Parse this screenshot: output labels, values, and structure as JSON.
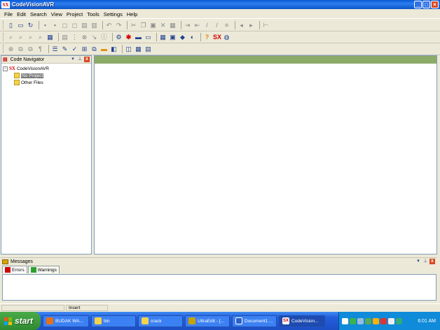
{
  "window": {
    "title": "CodeVisionAVR",
    "logo_text": "SX",
    "controls": [
      "_",
      "□",
      "×"
    ]
  },
  "menu": [
    "File",
    "Edit",
    "Search",
    "View",
    "Project",
    "Tools",
    "Settings",
    "Help"
  ],
  "toolbar1": {
    "icons": [
      "new-file-icon",
      "open-folder-icon",
      "reload-icon",
      "save-icon",
      "save-all-icon",
      "close-icon",
      "close-all-icon",
      "print-preview-icon",
      "print-icon",
      "undo-icon",
      "redo-icon",
      "cut-icon",
      "copy-icon",
      "paste-icon",
      "delete-icon",
      "select-all-icon",
      "indent-icon",
      "unindent-icon",
      "comment-icon",
      "uncomment-icon",
      "bookmark-icon",
      "go-back-icon",
      "go-forward-icon",
      "split-icon"
    ]
  },
  "toolbar2": {
    "icons": [
      "find-icon",
      "find-next-icon",
      "find-prev-icon",
      "replace-icon",
      "project-icon",
      "make-icon",
      "build-all-icon",
      "stop-icon",
      "debug-icon",
      "info-icon",
      "configure-icon",
      "bug-icon",
      "chip-icon",
      "programmer-icon",
      "wizard-icon",
      "terminal-icon",
      "chip-settings-icon",
      "help-icon",
      "codevision-icon",
      "web-icon"
    ],
    "help_glyph": "?",
    "logo_glyph": "SX"
  },
  "toolbar3": {
    "icons": [
      "bookmark-toggle-icon",
      "bookmark-next-icon",
      "bookmark-prev-icon",
      "paragraph-icon",
      "navigator-toggle-icon",
      "code-templates-icon",
      "clipboard-history-icon",
      "messages-toggle-icon",
      "panel-icon",
      "layout-1-icon",
      "layout-2-icon",
      "layout-3-icon"
    ]
  },
  "navigator": {
    "title": "Code Navigator",
    "root": "CodeVisionAVR",
    "expander": "-",
    "items": [
      {
        "label": "No Project",
        "selected": true
      },
      {
        "label": "Other Files",
        "selected": false
      }
    ],
    "controls": [
      "▾",
      "⊥",
      "x"
    ]
  },
  "messages": {
    "title": "Messages",
    "tabs": [
      {
        "label": "Errors",
        "active": true
      },
      {
        "label": "Warnings",
        "active": false
      }
    ],
    "controls": [
      "▾",
      "⊥",
      "x"
    ]
  },
  "status": {
    "cells": [
      "",
      "Insert"
    ]
  },
  "taskbar": {
    "start_label": "start",
    "tasks": [
      {
        "label": "BUDAK WA...",
        "icon_color": "#e3711a"
      },
      {
        "label": "bin",
        "icon_color": "#f4d34a"
      },
      {
        "label": "crack",
        "icon_color": "#f4d34a"
      },
      {
        "label": "UltraEdit - [...",
        "icon_color": "#c8a200"
      },
      {
        "label": "Document1 ...",
        "icon_color": "#2b5fc9"
      },
      {
        "label": "CodeVision...",
        "icon_color": "#d00000"
      }
    ],
    "clock": "6:01 AM",
    "colors": {
      "tray": "#0f8bd9",
      "bar": "#245edb",
      "start": "#2f8a2f"
    }
  }
}
